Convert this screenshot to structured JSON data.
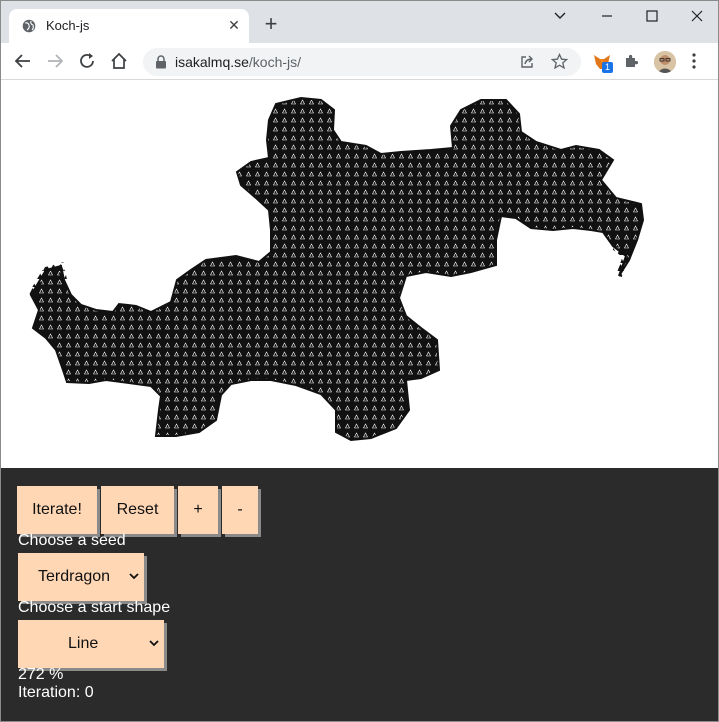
{
  "browser": {
    "tab_title": "Koch-js",
    "tab_close": "✕",
    "new_tab": "+",
    "url_host": "isakalmq.se",
    "url_path": "/koch-js/",
    "extension_badge": "1"
  },
  "controls": {
    "iterate_label": "Iterate!",
    "reset_label": "Reset",
    "zoom_in_label": "+",
    "zoom_out_label": "-",
    "seed_label": "Choose a seed",
    "seed_value": "Terdragon",
    "shape_label": "Choose a start shape",
    "shape_value": "Line",
    "zoom_text": "272 %",
    "iteration_text": "Iteration: 0"
  },
  "colors": {
    "button_bg": "#ffd7b5",
    "page_bg": "#2b2b2b",
    "canvas_bg": "#ffffff",
    "fractal": "#111111"
  }
}
